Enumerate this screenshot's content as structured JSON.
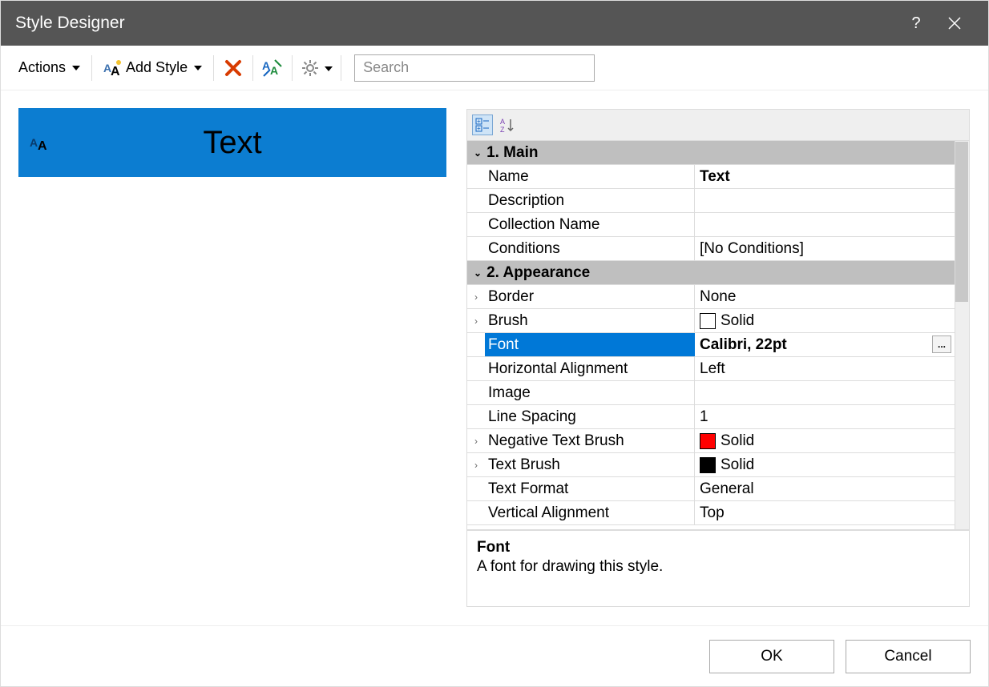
{
  "title": "Style Designer",
  "toolbar": {
    "actions_label": "Actions",
    "add_style_label": "Add Style",
    "search_placeholder": "Search"
  },
  "preview": {
    "text": "Text"
  },
  "property_grid": {
    "categories": [
      {
        "title": "1. Main",
        "rows": [
          {
            "label": "Name",
            "value": "Text",
            "bold": true
          },
          {
            "label": "Description",
            "value": ""
          },
          {
            "label": "Collection Name",
            "value": ""
          },
          {
            "label": "Conditions",
            "value": "[No Conditions]"
          }
        ]
      },
      {
        "title": "2. Appearance",
        "rows": [
          {
            "label": "Border",
            "value": "None",
            "expandable": true
          },
          {
            "label": "Brush",
            "value": "Solid",
            "swatch": "#ffffff",
            "expandable": true
          },
          {
            "label": "Font",
            "value": "Calibri, 22pt",
            "expandable": true,
            "selected": true,
            "ellipsis": true
          },
          {
            "label": "Horizontal Alignment",
            "value": "Left"
          },
          {
            "label": "Image",
            "value": ""
          },
          {
            "label": "Line Spacing",
            "value": "1"
          },
          {
            "label": "Negative Text Brush",
            "value": "Solid",
            "swatch": "#ff0000",
            "expandable": true
          },
          {
            "label": "Text Brush",
            "value": "Solid",
            "swatch": "#000000",
            "expandable": true
          },
          {
            "label": "Text Format",
            "value": "General"
          },
          {
            "label": "Vertical Alignment",
            "value": "Top"
          }
        ]
      }
    ],
    "help_title": "Font",
    "help_text": "A font for drawing this style."
  },
  "footer": {
    "ok_label": "OK",
    "cancel_label": "Cancel"
  }
}
